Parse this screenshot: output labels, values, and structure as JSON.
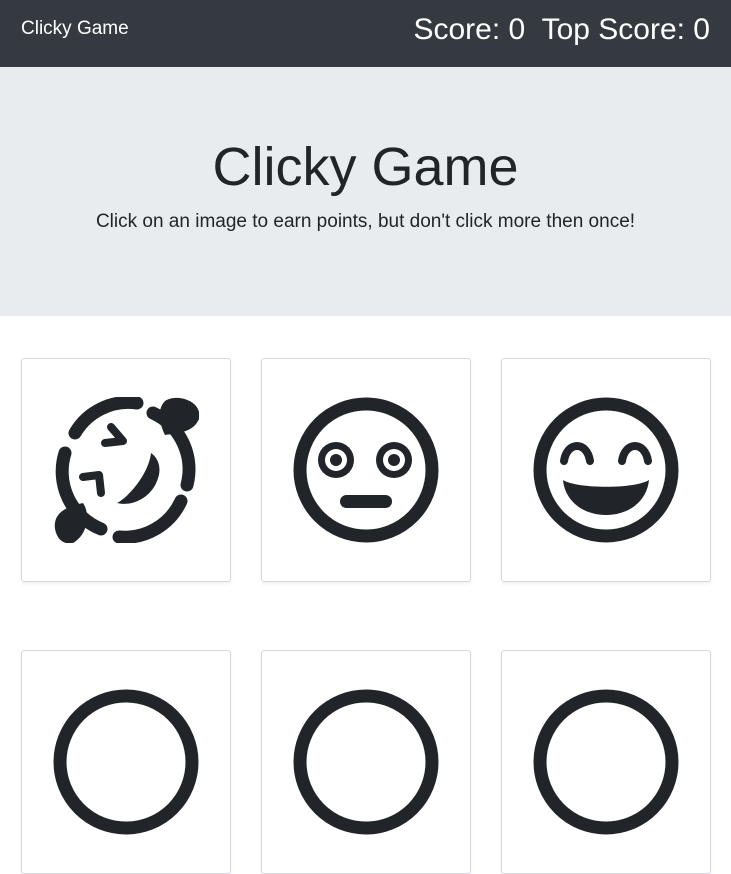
{
  "navbar": {
    "brand": "Clicky Game",
    "score_text": "Score: 0",
    "top_score_text": "Top Score: 0"
  },
  "jumbotron": {
    "title": "Clicky Game",
    "subtitle": "Click on an image to earn points, but don't click more then once!"
  },
  "cards": [
    {
      "icon": "grin-squint-tears-icon"
    },
    {
      "icon": "flushed-face-icon"
    },
    {
      "icon": "grin-beam-icon"
    },
    {
      "icon": "emoji-face-icon"
    },
    {
      "icon": "emoji-face-icon"
    },
    {
      "icon": "emoji-face-icon"
    }
  ],
  "colors": {
    "navbar_bg": "#343a40",
    "jumbotron_bg": "#e9ecef",
    "icon_color": "#212529"
  }
}
